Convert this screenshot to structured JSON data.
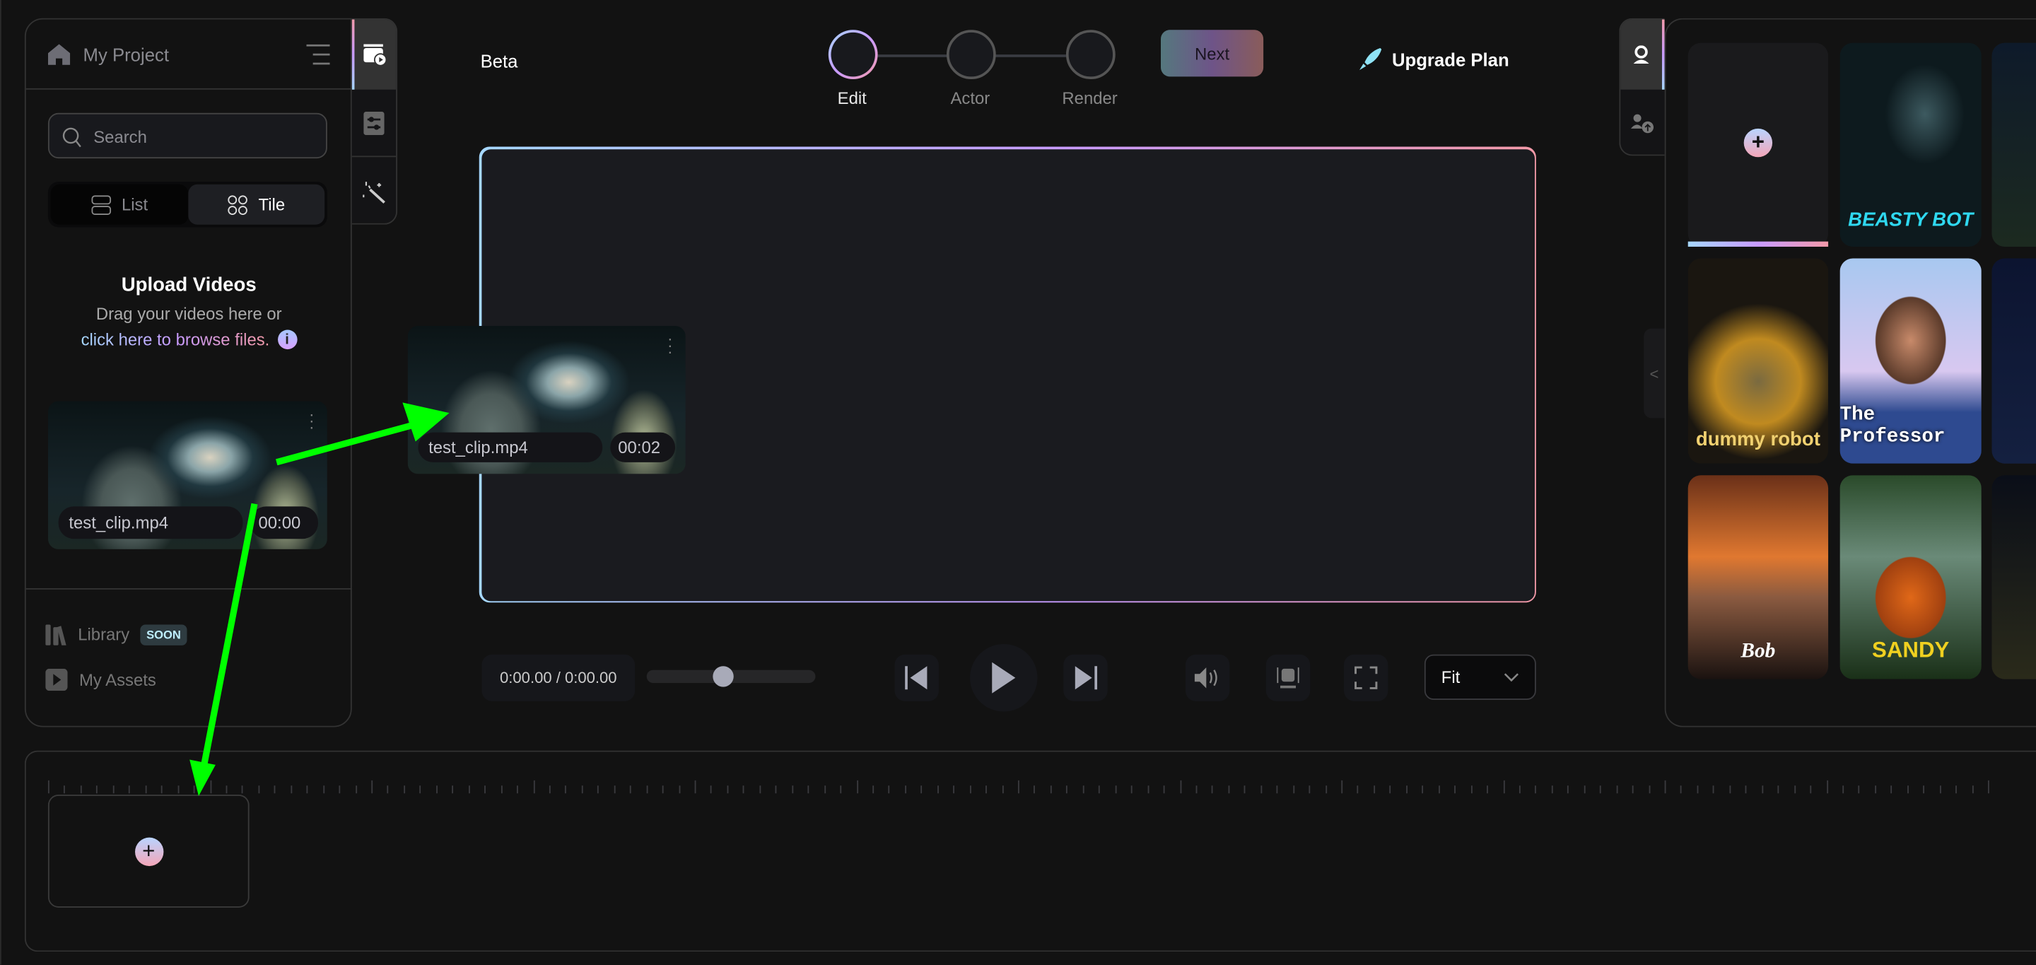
{
  "project": {
    "title": "My Project",
    "home_icon": "home-icon",
    "menu_icon": "menu-icon"
  },
  "left_tabs": [
    {
      "icon": "video-clip-icon",
      "active": true
    },
    {
      "icon": "adjustments-icon"
    },
    {
      "icon": "magic-wand-icon"
    }
  ],
  "search": {
    "placeholder": "Search"
  },
  "view_toggle": {
    "list": "List",
    "tile": "Tile",
    "selected": "Tile"
  },
  "upload": {
    "title": "Upload Videos",
    "subtitle": "Drag your videos here or",
    "link": "click here to browse files."
  },
  "media": [
    {
      "name": "test_clip.mp4",
      "duration": "00:00"
    }
  ],
  "drag_ghost": {
    "name": "test_clip.mp4",
    "duration": "00:02"
  },
  "nav": {
    "library": "Library",
    "library_badge": "SOON",
    "my_assets": "My Assets"
  },
  "header": {
    "beta": "Beta",
    "steps": [
      "Edit",
      "Actor",
      "Render"
    ],
    "active_step": "Edit",
    "next": "Next",
    "upgrade": "Upgrade Plan"
  },
  "player": {
    "time": "0:00.00 / 0:00.00",
    "progress_percent": 45,
    "fit": "Fit"
  },
  "right_tabs": [
    {
      "icon": "actor-icon",
      "active": true
    },
    {
      "icon": "upload-actor-icon"
    }
  ],
  "actors": [
    "BEASTY BOT",
    "dummy robot",
    "The Professor",
    "Bob",
    "SANDY"
  ],
  "colors": {
    "bg": "#121212",
    "accent_start": "#a6d8ff",
    "accent_mid": "#c89bff",
    "accent_end": "#f49aa8",
    "annotation": "#00ff00"
  }
}
